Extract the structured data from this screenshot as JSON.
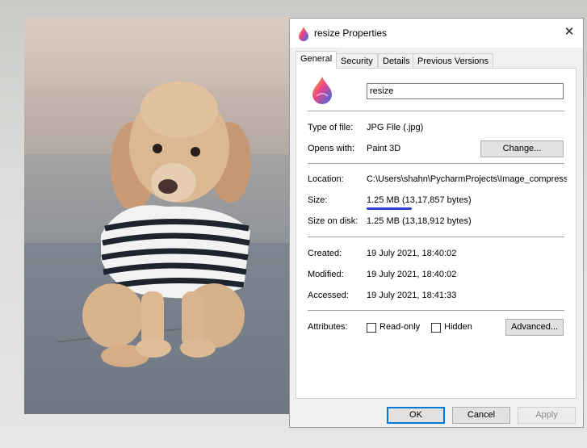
{
  "dialog": {
    "title": "resize Properties",
    "close_glyph": "✕",
    "tabs": [
      {
        "label": "General",
        "active": true
      },
      {
        "label": "Security",
        "active": false
      },
      {
        "label": "Details",
        "active": false
      },
      {
        "label": "Previous Versions",
        "active": false
      }
    ]
  },
  "general": {
    "filename": "resize",
    "type_label": "Type of file:",
    "type_value": "JPG File (.jpg)",
    "opens_label": "Opens with:",
    "opens_value": "Paint 3D",
    "change_button": "Change...",
    "location_label": "Location:",
    "location_value": "C:\\Users\\shahn\\PycharmProjects\\Image_compress",
    "size_label": "Size:",
    "size_value": "1.25 MB (13,17,857 bytes)",
    "size_disk_label": "Size on disk:",
    "size_disk_value": "1.25 MB (13,18,912 bytes)",
    "created_label": "Created:",
    "created_value": "19 July 2021, 18:40:02",
    "modified_label": "Modified:",
    "modified_value": "19 July 2021, 18:40:02",
    "accessed_label": "Accessed:",
    "accessed_value": "19 July 2021, 18:41:33",
    "attributes_label": "Attributes:",
    "readonly_label": "Read-only",
    "readonly_checked": false,
    "hidden_label": "Hidden",
    "hidden_checked": false,
    "advanced_button": "Advanced..."
  },
  "footer": {
    "ok": "OK",
    "cancel": "Cancel",
    "apply": "Apply"
  },
  "colors": {
    "accent": "#0078d7",
    "highlight_underline": "#2b3fd0"
  },
  "icons": {
    "app": "paint-3d-icon",
    "close": "close-icon"
  }
}
